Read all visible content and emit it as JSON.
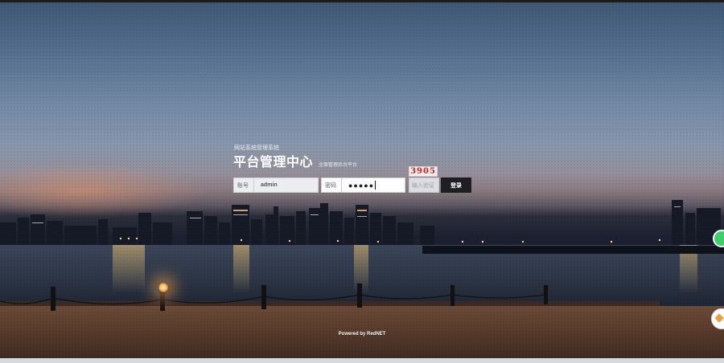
{
  "login": {
    "subtitle": "网站系统管理系统",
    "title": "平台管理中心",
    "tagline": "全面管理后台平台",
    "username_label": "账号",
    "username_value": "admin",
    "password_label": "密码",
    "password_value": "●●●●●",
    "captcha_code": "3905",
    "captcha_placeholder": "输入验证",
    "login_button": "登录"
  },
  "footer": {
    "powered_by": "Powered by RedNET"
  },
  "colors": {
    "button_bg": "#1e1f22",
    "captcha_text": "#d41f1f"
  }
}
